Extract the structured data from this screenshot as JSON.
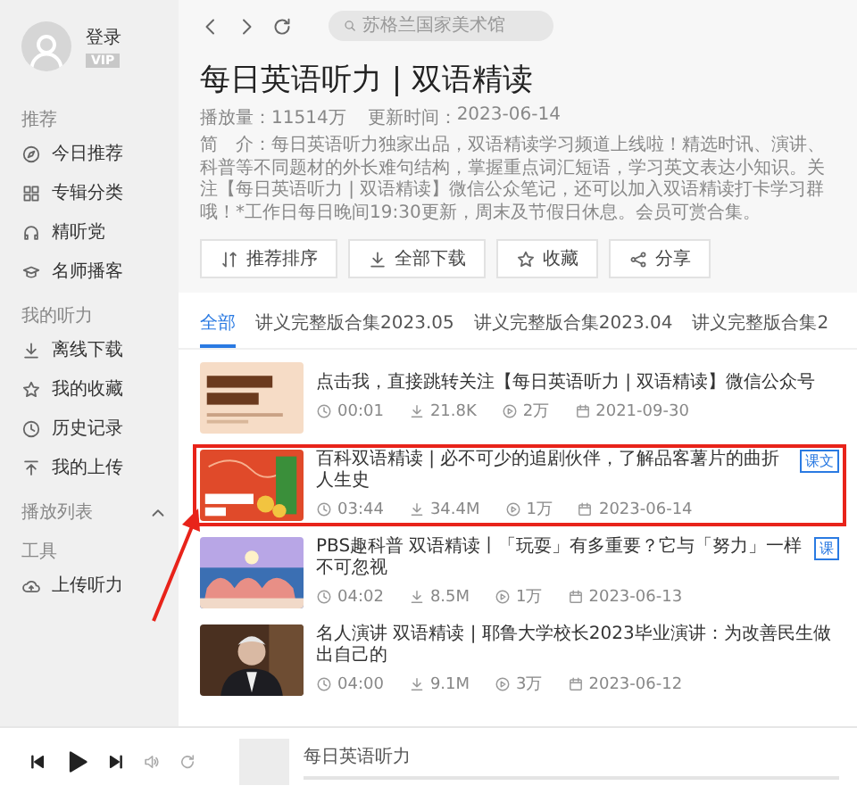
{
  "sidebar": {
    "user": {
      "name": "登录",
      "badge": "VIP"
    },
    "sections": [
      {
        "title": "推荐",
        "items": [
          {
            "label": "今日推荐"
          },
          {
            "label": "专辑分类"
          },
          {
            "label": "精听党"
          },
          {
            "label": "名师播客"
          }
        ]
      },
      {
        "title": "我的听力",
        "items": [
          {
            "label": "离线下载"
          },
          {
            "label": "我的收藏"
          },
          {
            "label": "历史记录"
          },
          {
            "label": "我的上传"
          }
        ]
      },
      {
        "title": "播放列表",
        "expanded": true
      },
      {
        "title": "工具",
        "items": [
          {
            "label": "上传听力"
          }
        ]
      }
    ]
  },
  "search": {
    "placeholder": "苏格兰国家美术馆"
  },
  "album": {
    "title": "每日英语听力 | 双语精读",
    "plays_label": "播放量：",
    "plays": "11514万",
    "updated_label": "更新时间：",
    "updated": "2023-06-14",
    "description": "简　介：每日英语听力独家出品，双语精读学习频道上线啦！精选时讯、演讲、科普等不同题材的外长难句结构，掌握重点词汇短语，学习英文表达小知识。关注【每日英语听力 | 双语精读】微信公众笔记，还可以加入双语精读打卡学习群哦！*工作日每日晚间19:30更新，周末及节假日休息。会员可赏合集。"
  },
  "actions": [
    "推荐排序",
    "全部下载",
    "收藏",
    "分享"
  ],
  "tabs": [
    {
      "label": "全部",
      "selected": true
    },
    {
      "label": "讲义完整版合集2023.05",
      "selected": false
    },
    {
      "label": "讲义完整版合集2023.04",
      "selected": false
    },
    {
      "label": "讲义完整版合集2",
      "selected": false
    }
  ],
  "tracks": [
    {
      "title": "点击我，直接跳转关注【每日英语听力 | 双语精读】微信公众号",
      "duration": "00:01",
      "size": "21.8K",
      "plays": "2万",
      "date": "2021-09-30",
      "highlighted": false
    },
    {
      "title": "百科双语精读 | 必不可少的追剧伙伴，了解品客薯片的曲折人生史",
      "badge": "课文",
      "duration": "03:44",
      "size": "34.4M",
      "plays": "1万",
      "date": "2023-06-14",
      "highlighted": true
    },
    {
      "title": "PBS趣科普 双语精读丨「玩耍」有多重要？它与「努力」一样不可忽视",
      "badge": "课",
      "duration": "04:02",
      "size": "8.5M",
      "plays": "1万",
      "date": "2023-06-13",
      "highlighted": false
    },
    {
      "title": "名人演讲 双语精读 | 耶鲁大学校长2023毕业演讲：为改善民生做出自己的",
      "duration": "04:00",
      "size": "9.1M",
      "plays": "3万",
      "date": "2023-06-12",
      "highlighted": false
    }
  ],
  "annotation_arrow": true,
  "player": {
    "track": "每日英语听力"
  }
}
